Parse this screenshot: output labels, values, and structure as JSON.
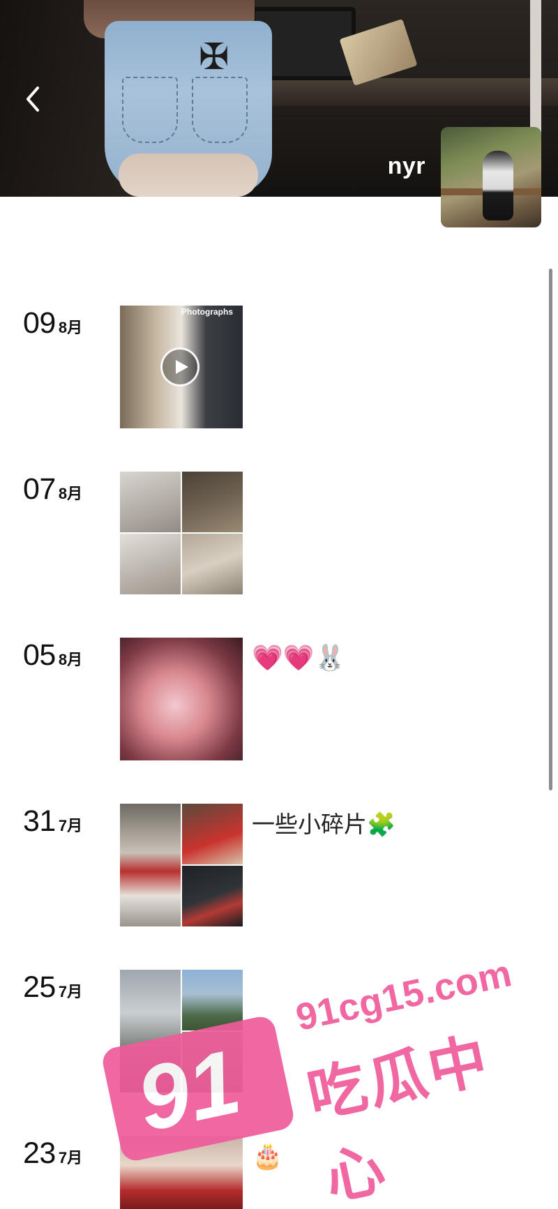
{
  "profile": {
    "name": "nyr",
    "back_icon": "chevron-left-icon"
  },
  "posts": [
    {
      "day": "09",
      "month": "8月",
      "caption": "",
      "media": "video",
      "media_text": "Photographs"
    },
    {
      "day": "07",
      "month": "8月",
      "caption": "",
      "media": "grid-4"
    },
    {
      "day": "05",
      "month": "8月",
      "caption": "💗💗🐰",
      "media": "single"
    },
    {
      "day": "31",
      "month": "7月",
      "caption": "一些小碎片🧩",
      "media": "grid-3"
    },
    {
      "day": "25",
      "month": "7月",
      "caption": "",
      "media": "grid-3"
    },
    {
      "day": "23",
      "month": "7月",
      "caption": "🎂",
      "media": "single"
    }
  ],
  "watermark": {
    "number": "91",
    "domain": "91cg15.com",
    "brand": "吃瓜中心"
  },
  "colors": {
    "watermark_pink": "#ef5c9b",
    "background": "#ffffff",
    "text": "#111111"
  }
}
